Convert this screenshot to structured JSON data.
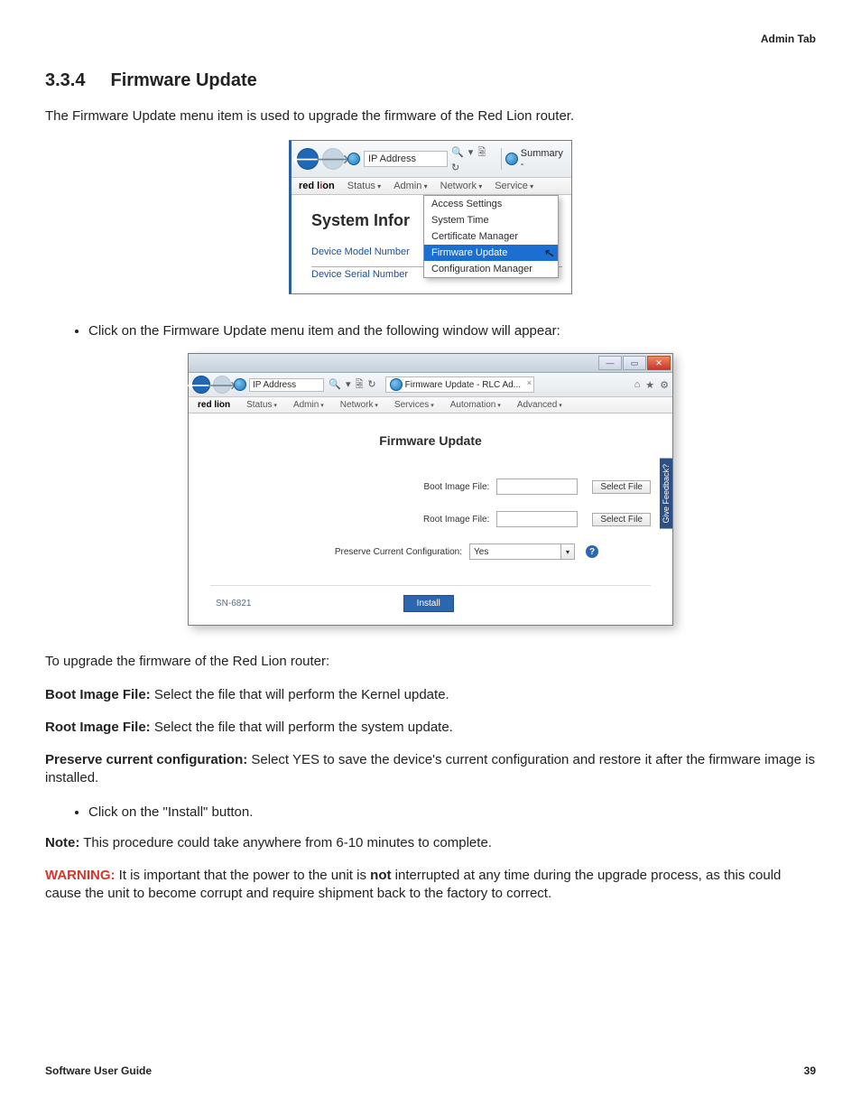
{
  "header": {
    "tab": "Admin Tab"
  },
  "section": {
    "number": "3.3.4",
    "title": "Firmware Update"
  },
  "intro": "The Firmware Update menu item is used to upgrade the firmware of the Red Lion router.",
  "bullet1": "Click on the Firmware Update menu item and the following window will appear:",
  "para_upgrade": "To upgrade the firmware of the Red Lion router:",
  "boot_label": "Boot Image File:",
  "boot_text": " Select the file that will perform the Kernel update.",
  "root_label": "Root Image File:",
  "root_text": " Select the file that will perform the system update.",
  "preserve_label": "Preserve current configuration:",
  "preserve_text": " Select YES to save the device's current configuration and restore it after the firmware image is installed.",
  "bullet2": "Click on the \"Install\" button.",
  "note_label": "Note:",
  "note_text": " This procedure could take anywhere from 6-10 minutes to complete.",
  "warn_label": "WARNING:",
  "warn_pre": " It is important that the power to the unit is ",
  "warn_not": "not",
  "warn_post": " interrupted at any time during the upgrade process, as this could cause the unit to become corrupt and require shipment back to the factory to correct.",
  "footer": {
    "left": "Software User Guide",
    "right": "39"
  },
  "fig1": {
    "addr": "IP Address",
    "search_symbols": "🔍 ▾ 🗟 ↻",
    "tab": "Summary -",
    "brand_pre": "red l",
    "brand_o": "i͘",
    "brand_post": "on",
    "menu": {
      "status": "Status",
      "admin": "Admin",
      "network": "Network",
      "service": "Service"
    },
    "heading": "System Infor",
    "row1": "Device Model Number",
    "row2": "Device Serial Number",
    "dropdown": {
      "access": "Access Settings",
      "time": "System Time",
      "cert": "Certificate Manager",
      "fw": "Firmware Update",
      "cfg": "Configuration Manager"
    }
  },
  "fig2": {
    "addr": "IP Address",
    "search_symbols": "🔍 ▾ 🗟 ↻",
    "tab": "Firmware Update - RLC Ad...",
    "brand": "red li͘on",
    "menu": {
      "status": "Status",
      "admin": "Admin",
      "network": "Network",
      "services": "Services",
      "automation": "Automation",
      "advanced": "Advanced"
    },
    "title": "Firmware Update",
    "boot": "Boot Image File:",
    "root": "Root Image File:",
    "select": "Select File",
    "preserve": "Preserve Current Configuration:",
    "preserve_value": "Yes",
    "install": "Install",
    "model": "SN-6821",
    "feedback": "Give Feedback?",
    "winbtns": {
      "min": "—",
      "max": "▭",
      "close": "✕"
    },
    "toolbar": {
      "home": "⌂",
      "star": "★",
      "gear": "⚙"
    }
  }
}
